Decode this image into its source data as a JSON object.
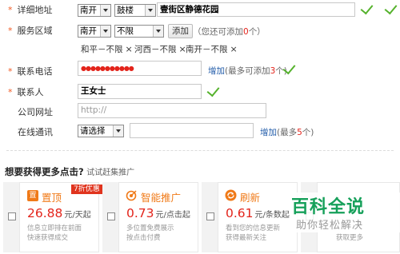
{
  "form": {
    "address": {
      "label": "详细地址",
      "district": "南开",
      "area": "鼓楼",
      "value": "壹街区静德花园"
    },
    "service_area": {
      "label": "服务区域",
      "district": "南开",
      "area": "不限",
      "add_button": "添加",
      "hint_prefix": "（您还可添加",
      "hint_count": "0",
      "hint_suffix": "个）",
      "tags": [
        "和平－不限",
        "河西－不限",
        "南开－不限"
      ],
      "remove_glyph": "×"
    },
    "phone": {
      "label": "联系电话",
      "value": "●●●●●●●●●●●",
      "add_link": "增加",
      "hint_prefix": "(最多可添加",
      "hint_count": "3",
      "hint_suffix": "个)"
    },
    "contact": {
      "label": "联系人",
      "value": "王女士"
    },
    "website": {
      "label": "公司网址",
      "placeholder": "http://"
    },
    "im": {
      "label": "在线通讯",
      "select_value": "请选择",
      "add_link": "增加",
      "hint_prefix": "(最多",
      "hint_count": "5",
      "hint_suffix": "个)"
    }
  },
  "promo_section": {
    "heading": "想要获得更多点击?",
    "subheading": "试试赶集推广",
    "cards": [
      {
        "icon": "置",
        "title": "置顶",
        "badge": "7折优惠",
        "price": "26.88",
        "unit": "元/天起",
        "desc1": "信息立即排在前面",
        "desc2": "快速获得成交"
      },
      {
        "icon": "target-icon",
        "title": "智能推广",
        "price": "0.73",
        "unit": "元/点击起",
        "desc1": "多位置免费展示",
        "desc2": "按点击付费"
      },
      {
        "icon": "refresh-icon",
        "title": "刷新",
        "price": "0.61",
        "unit": "元/条数起",
        "desc1": "看到您的信息更新",
        "desc2": "获得最新关注"
      },
      {
        "partial": "获取更多"
      }
    ]
  },
  "watermark": {
    "line1": "百科全说",
    "line2": "助你轻松解决"
  },
  "colors": {
    "required": "#f15a22",
    "check": "#55b22c",
    "accent": "#f07a18",
    "price": "#e3241b",
    "link": "#1f5aa8"
  }
}
